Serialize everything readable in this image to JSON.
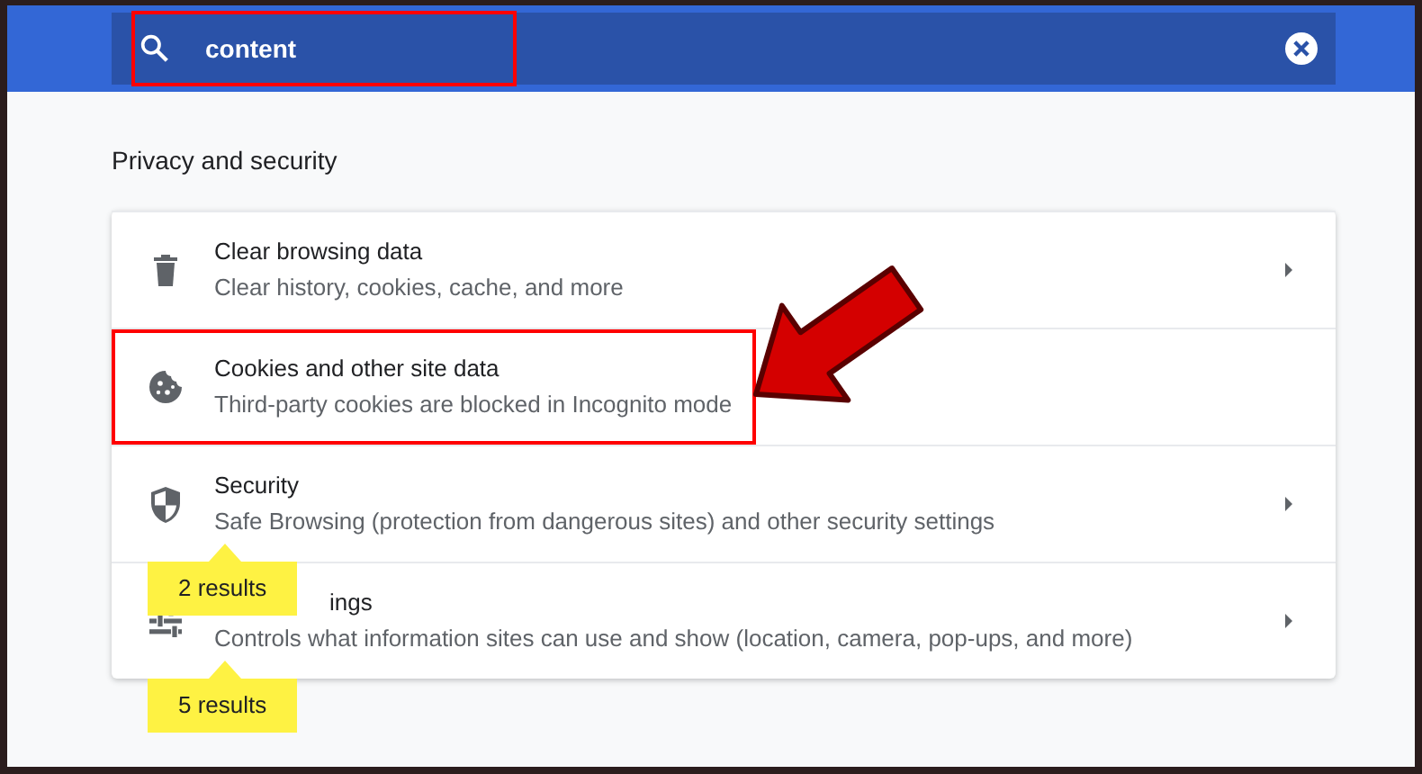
{
  "search": {
    "value": "content",
    "highlighted": true
  },
  "section_title": "Privacy and security",
  "rows": [
    {
      "kind": "trash",
      "title": "Clear browsing data",
      "subtitle": "Clear history, cookies, cache, and more",
      "highlighted": false,
      "title_covered": false
    },
    {
      "kind": "cookie",
      "title": "Cookies and other site data",
      "subtitle": "Third-party cookies are blocked in Incognito mode",
      "highlighted": true,
      "title_covered": false
    },
    {
      "kind": "shield",
      "title": "Security",
      "subtitle": "Safe Browsing (protection from dangerous sites) and other security settings",
      "highlighted": false,
      "title_covered": false,
      "results": "2 results"
    },
    {
      "kind": "sliders",
      "title": "ings",
      "subtitle": "Controls what information sites can use and show (location, camera, pop-ups, and more)",
      "highlighted": false,
      "title_covered": true,
      "results": "5 results"
    }
  ]
}
